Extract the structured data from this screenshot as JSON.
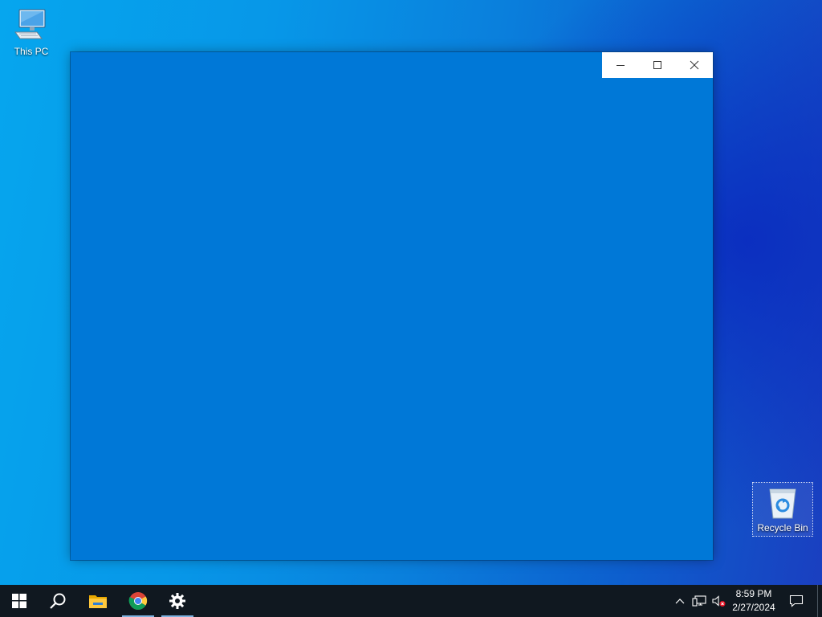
{
  "desktop": {
    "icons": [
      {
        "label": "This PC",
        "icon": "computer-icon"
      },
      {
        "label": "Recycle Bin",
        "icon": "recycle-bin-icon"
      }
    ]
  },
  "window": {
    "background": "#0078d7",
    "controls": [
      "minimize-icon",
      "maximize-icon",
      "close-icon"
    ]
  },
  "taskbar": {
    "items": [
      {
        "icon": "windows-logo-icon",
        "running": false
      },
      {
        "icon": "search-icon",
        "running": false
      },
      {
        "icon": "folder-icon",
        "running": false
      },
      {
        "icon": "chrome-icon",
        "running": true
      },
      {
        "icon": "gear-icon",
        "running": true
      }
    ],
    "tray": [
      "chevron-up-icon",
      "network-icon",
      "volume-muted-icon"
    ],
    "clock": {
      "time": "8:59 PM",
      "date": "2/27/2024"
    },
    "notifications_icon": "notification-icon"
  }
}
